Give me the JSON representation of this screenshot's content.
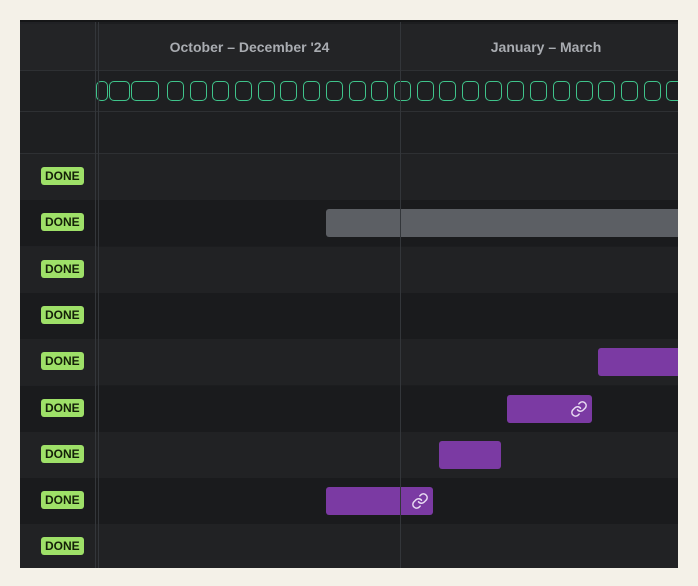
{
  "timeline": {
    "quarters": [
      "October – December '24",
      "January – March"
    ],
    "colors": {
      "background": "#1c1d1f",
      "week_outline": "#3fc48b",
      "done_badge": "#9ee068",
      "bar_gray": "#5c5f64",
      "bar_purple": "#7b3aa3"
    }
  },
  "rows": [
    {
      "status": "DONE",
      "bar": null
    },
    {
      "status": "DONE",
      "bar": {
        "color": "gray",
        "linked": false
      }
    },
    {
      "status": "DONE",
      "bar": null
    },
    {
      "status": "DONE",
      "bar": null
    },
    {
      "status": "DONE",
      "bar": {
        "color": "purple",
        "linked": false
      }
    },
    {
      "status": "DONE",
      "bar": {
        "color": "purple",
        "linked": true,
        "icon": "link-icon"
      }
    },
    {
      "status": "DONE",
      "bar": {
        "color": "purple",
        "linked": false
      }
    },
    {
      "status": "DONE",
      "bar": {
        "color": "purple",
        "linked": true,
        "icon": "link-icon"
      }
    },
    {
      "status": "DONE",
      "bar": null
    }
  ]
}
